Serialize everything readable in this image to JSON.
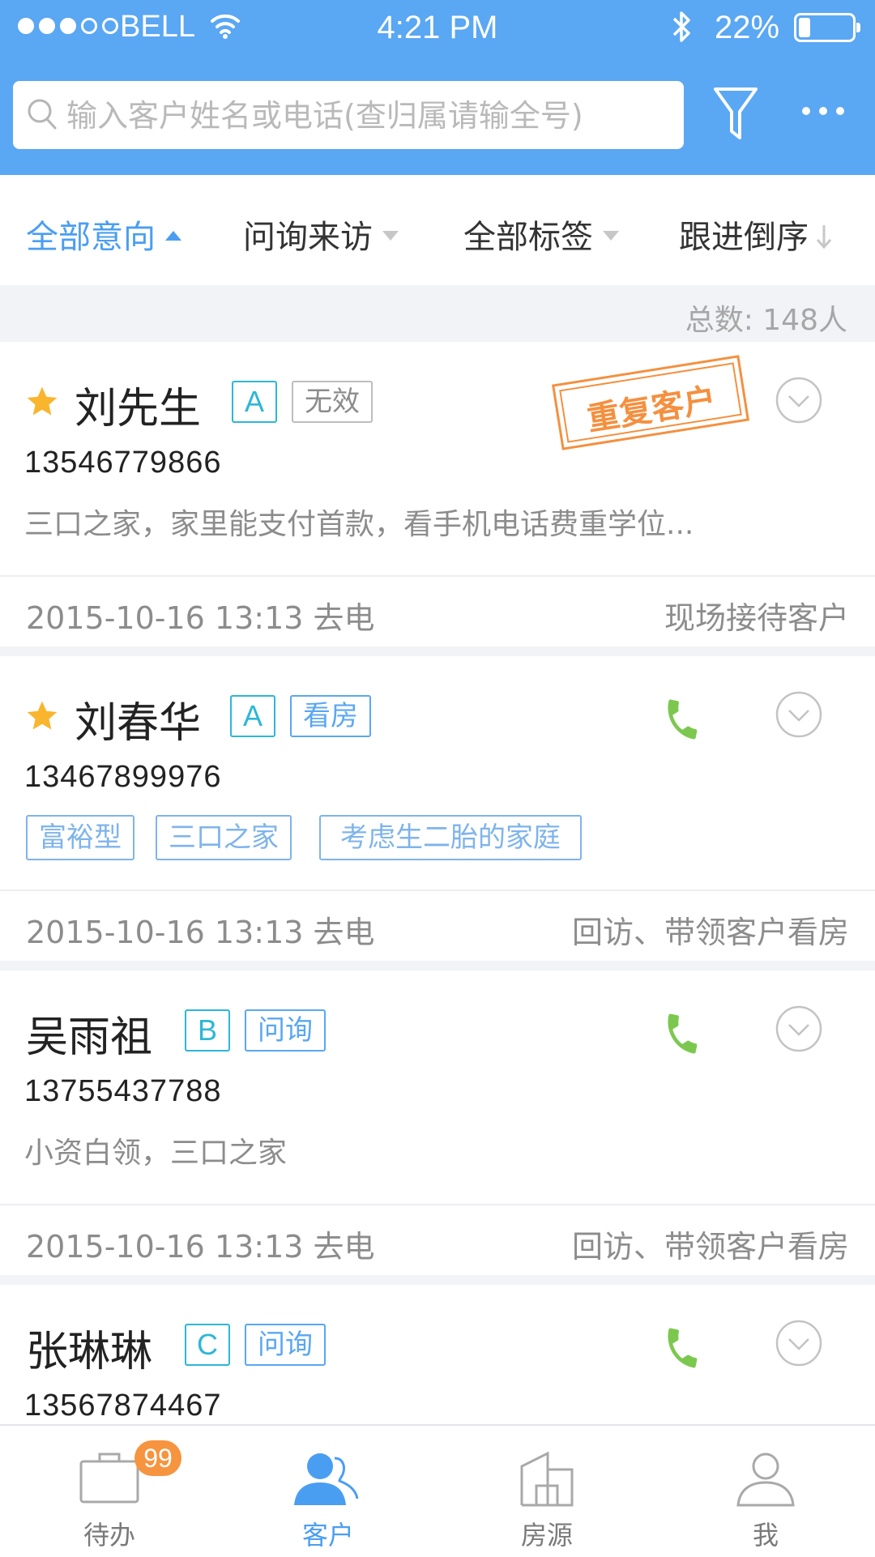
{
  "status": {
    "carrier": "BELL",
    "time": "4:21 PM",
    "battery_pct": "22%",
    "battery_level": 0.22,
    "signal_bars": 3,
    "signal_total": 5
  },
  "header": {
    "search_placeholder": "输入客户姓名或电话(查归属请输全号)",
    "search_icon": "search-icon",
    "filter_icon": "filter-icon",
    "more_icon": "more-icon"
  },
  "sort": {
    "intent": "全部意向",
    "source": "问询来访",
    "tags": "全部标签",
    "order": "跟进倒序"
  },
  "count_label": "总数: 148人",
  "customers": [
    {
      "starred": true,
      "name": "刘先生",
      "grade": "A",
      "status_tag": "无效",
      "stamp": "重复客户",
      "phone": "13546779866",
      "desc": "三口之家，家里能支付首款，看手机电话费重学位...",
      "followup": "2015-10-16 13:13 去电",
      "note": "现场接待客户"
    },
    {
      "starred": true,
      "name": "刘春华",
      "grade": "A",
      "status_tag": "看房",
      "chips": [
        "富裕型",
        "三口之家",
        "考虑生二胎的家庭"
      ],
      "phone": "13467899976",
      "followup": "2015-10-16 13:13 去电",
      "note": "回访、带领客户看房"
    },
    {
      "starred": false,
      "name": "吴雨祖",
      "grade": "B",
      "status_tag": "问询",
      "phone": "13755437788",
      "desc": "小资白领，三口之家",
      "followup": "2015-10-16 13:13 去电",
      "note": "回访、带领客户看房"
    },
    {
      "starred": false,
      "name": "张琳琳",
      "grade": "C",
      "status_tag": "问询",
      "phone": "13567874467"
    }
  ],
  "tabs": [
    {
      "label": "待办",
      "icon": "briefcase-icon",
      "badge": "99"
    },
    {
      "label": "客户",
      "icon": "customers-icon",
      "active": true
    },
    {
      "label": "房源",
      "icon": "building-icon"
    },
    {
      "label": "我",
      "icon": "profile-icon"
    }
  ],
  "colors": {
    "primary": "#5aa7f3",
    "grade": "#2db7d6",
    "stamp": "#f4903f",
    "call": "#7cc84f",
    "badge": "#f6943f"
  }
}
